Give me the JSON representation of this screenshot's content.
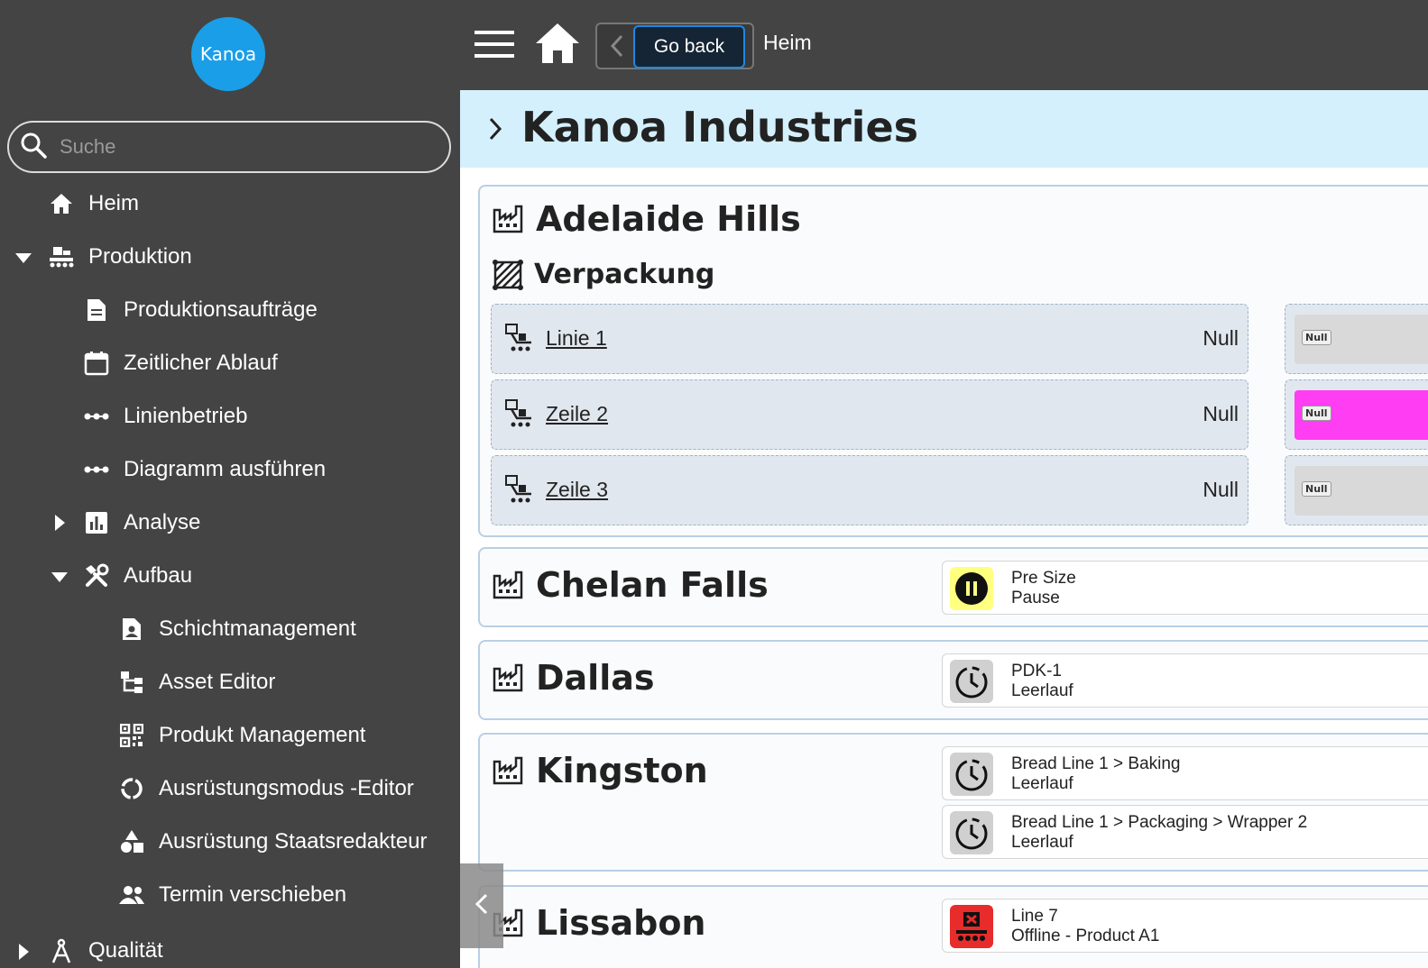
{
  "sidebar": {
    "logo_text": "Kanoa",
    "search_placeholder": "Suche",
    "items": {
      "home": "Heim",
      "produktion": "Produktion",
      "auftraege": "Produktionsaufträge",
      "ablauf": "Zeitlicher Ablauf",
      "linienbetrieb": "Linienbetrieb",
      "diagramm": "Diagramm ausführen",
      "analyse": "Analyse",
      "aufbau": "Aufbau",
      "schicht": "Schichtmanagement",
      "asset": "Asset Editor",
      "produkt": "Produkt Management",
      "modus": "Ausrüstungsmodus -Editor",
      "staats": "Ausrüstung Staatsredakteur",
      "termin": "Termin verschieben",
      "qualitaet": "Qualität"
    }
  },
  "topbar": {
    "back_label": "Go back",
    "breadcrumb": "Heim"
  },
  "main": {
    "enterprise": "Kanoa Industries",
    "sites": {
      "adelaide": {
        "name": "Adelaide Hills",
        "area": "Verpackung",
        "lines": [
          {
            "name": "Linie 1",
            "value": "Null",
            "state_label": "Null",
            "state_color": "#d9d9d9"
          },
          {
            "name": "Zeile 2",
            "value": "Null",
            "state_label": "Null",
            "state_color": "#ff3df2"
          },
          {
            "name": "Zeile 3",
            "value": "Null",
            "state_label": "Null",
            "state_color": "#d9d9d9"
          }
        ]
      },
      "chelan": {
        "name": "Chelan Falls",
        "status": [
          {
            "line1": "Pre Size",
            "line2": "Pause",
            "icon": "pause-icon",
            "color": "#ffff80"
          }
        ]
      },
      "dallas": {
        "name": "Dallas",
        "status": [
          {
            "line1": "PDK-1",
            "line2": "Leerlauf",
            "icon": "clock-icon",
            "color": "#d0d0d0"
          }
        ]
      },
      "kingston": {
        "name": "Kingston",
        "status": [
          {
            "line1": "Bread Line 1 > Baking",
            "line2": "Leerlauf",
            "icon": "clock-icon",
            "color": "#d0d0d0"
          },
          {
            "line1": "Bread Line 1 > Packaging > Wrapper 2",
            "line2": "Leerlauf",
            "icon": "clock-icon",
            "color": "#d0d0d0"
          }
        ]
      },
      "lissabon": {
        "name": "Lissabon",
        "status": [
          {
            "line1": "Line 7",
            "line2": "Offline - Product A1",
            "icon": "offline-conveyor-icon",
            "color": "#e82b2b"
          }
        ]
      }
    }
  },
  "colors": {
    "sidebar_bg": "#444444",
    "enterprise_bg": "#d4f0fc",
    "accent": "#1a9ee8"
  }
}
